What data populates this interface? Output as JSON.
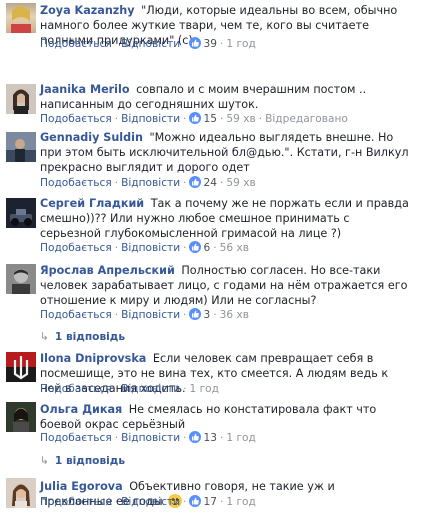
{
  "labels": {
    "like": "Подобається",
    "reply": "Відповісти",
    "edited": "Відредаговано"
  },
  "comments": [
    {
      "author": "Zoya Kazanzhy",
      "text": "\"Люди, которые идеальны во всем, обычно намного более жуткие твари, чем те, кого вы считаете полными придурками\" (с)",
      "likes": "39",
      "time": "1 год",
      "replies": ""
    },
    {
      "author": "Jaanika Merilo",
      "text": "совпало и с моим вчерашним постом .. написанным до сегодняшних шуток.",
      "likes": "15",
      "time": "59 хв",
      "replies": ""
    },
    {
      "author": "Gennadiy Suldin",
      "text": "\"Можно идеально выглядеть внешне. Но при этом быть исключительной бл@дью.\". Кстати, г-н Вилкул прекрасно выглядит и дорого одет",
      "likes": "24",
      "time": "59 хв",
      "replies": ""
    },
    {
      "author": "Сергей Гладкий",
      "text": "Так а почему же не поржать если и правда смешно))?? Или нужно любое смешное принимать с серьезной глубокомысленной гримасой на лице ?)",
      "likes": "6",
      "time": "56 хв",
      "replies": ""
    },
    {
      "author": "Ярослав Апрельский",
      "text": "Полностью согласен. Но все-таки человек зарабатывает лицо, с годами на нём отражается его отношение к миру и людям) Или не согласны?",
      "likes": "3",
      "time": "36 хв",
      "replies": "1 відповідь"
    },
    {
      "author": "Ilona Dniprovska",
      "text": "Если человек сам превращает себя в посмешище, это не вина тех, кто смеется. А людям ведь к ней в заседания ходить.",
      "likes": "",
      "time": "1 год",
      "replies": ""
    },
    {
      "author": "Ольга Дикая",
      "text": "Не смеялась но констатировала факт что боевой окрас серьёзный",
      "likes": "13",
      "time": "1 год",
      "replies": "1 відповідь"
    },
    {
      "author": "Julia Egorova",
      "text": "Объективно говоря, не такие уж и преклонные ее годы",
      "likes": "17",
      "time": "1 год",
      "replies": ""
    }
  ],
  "colors": {
    "link": "#365899",
    "meta": "#90949c",
    "text": "#1d2129",
    "like": "#5890ff"
  }
}
